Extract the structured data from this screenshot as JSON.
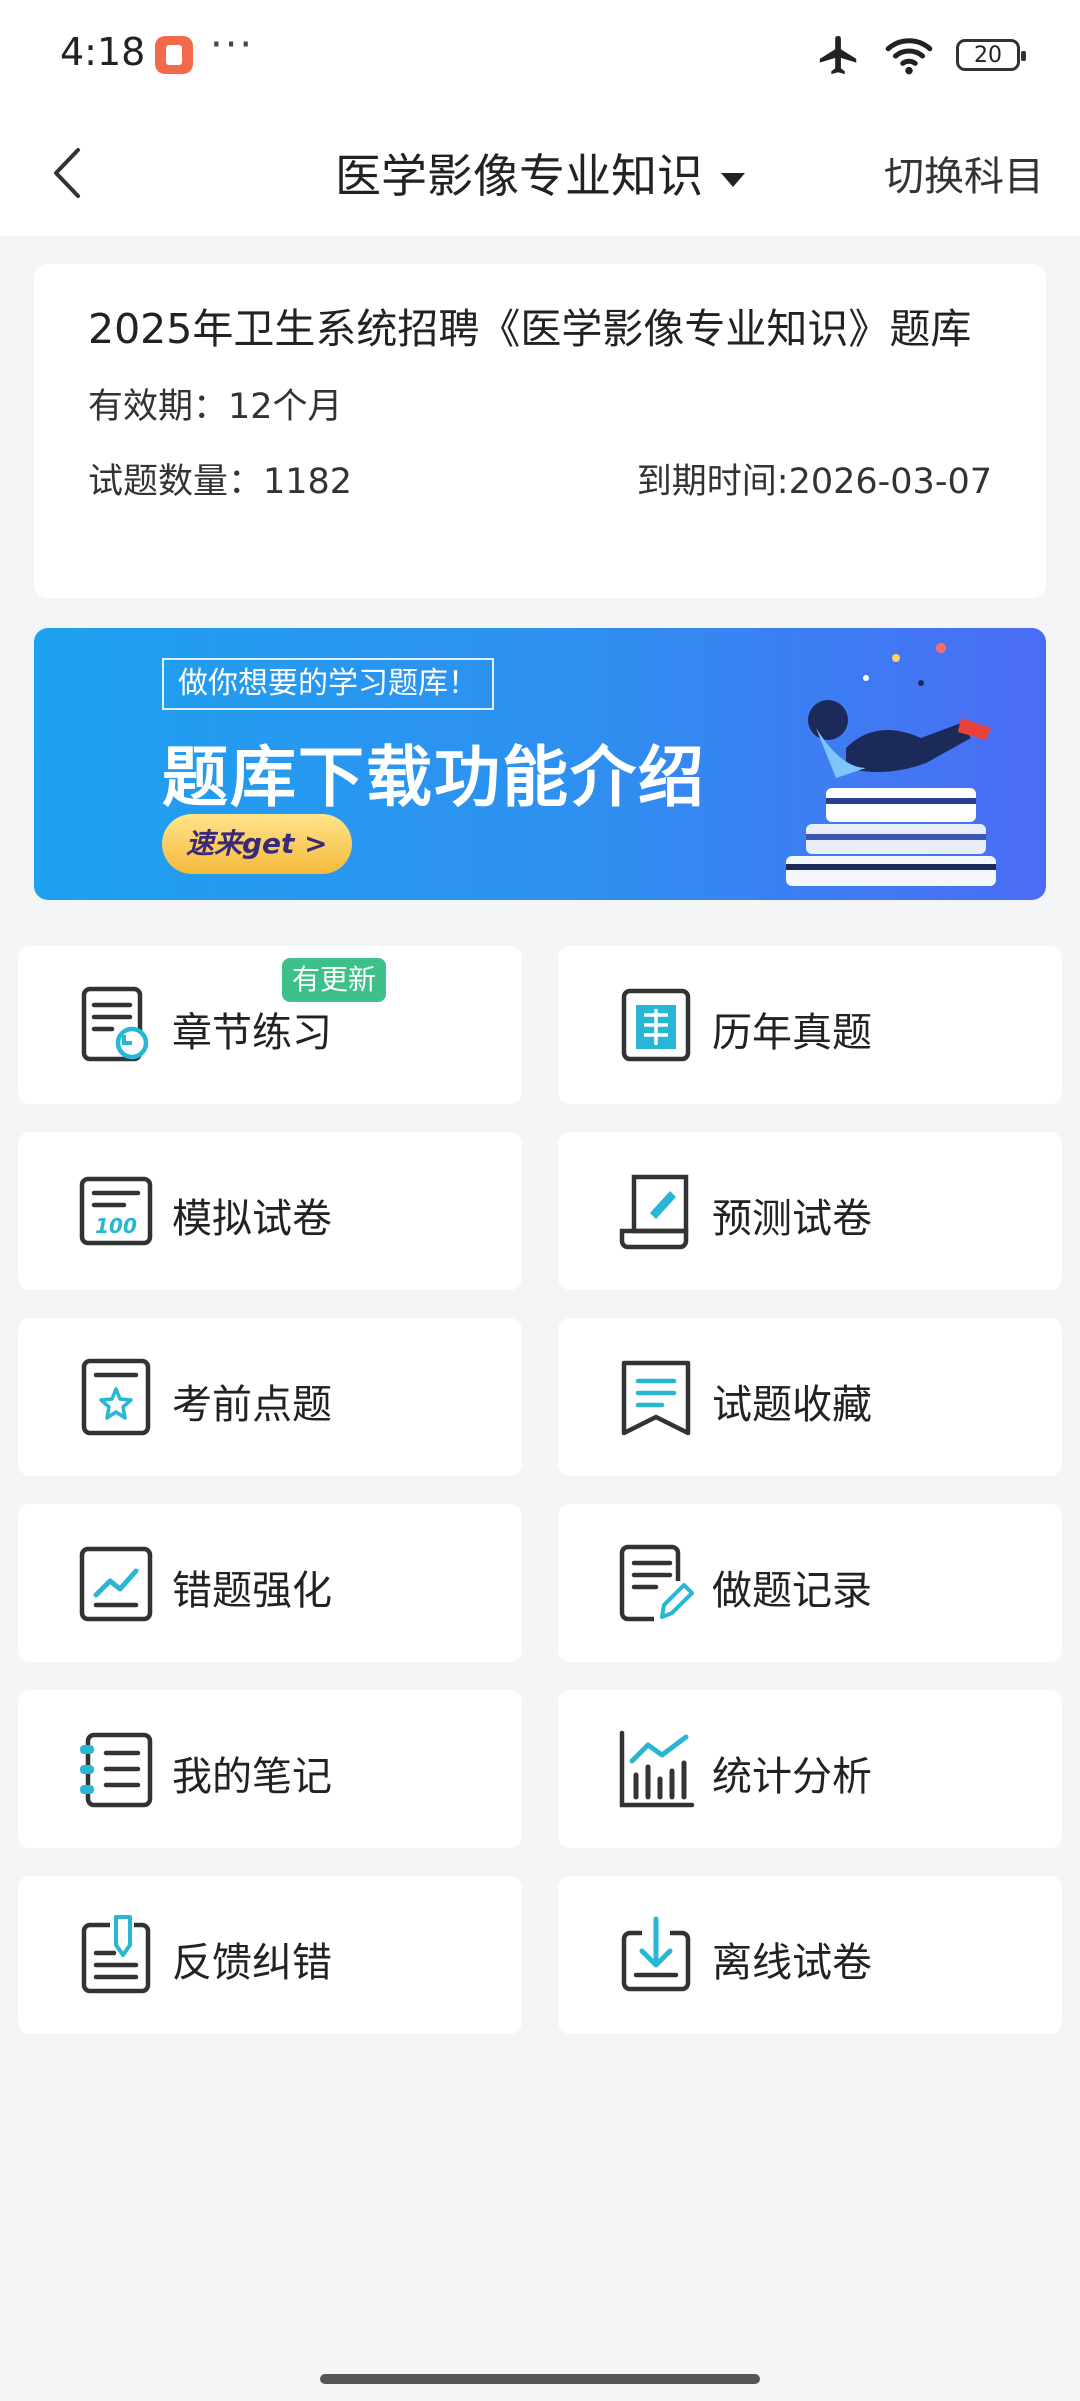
{
  "status_bar": {
    "time": "4:18",
    "more": "···",
    "battery": "20"
  },
  "nav": {
    "title": "医学影像专业知识",
    "switch": "切换科目"
  },
  "info": {
    "title": "2025年卫生系统招聘《医学影像专业知识》题库",
    "validity": "有效期：12个月",
    "count": "试题数量：1182",
    "expiry": "到期时间:2026-03-07"
  },
  "banner": {
    "tag": "做你想要的学习题库！",
    "headline": "题库下载功能介绍",
    "cta": "速来get >"
  },
  "menu": {
    "badge": "有更新",
    "items": [
      {
        "label": "章节练习",
        "icon": "chapter-practice-icon"
      },
      {
        "label": "历年真题",
        "icon": "past-exams-icon"
      },
      {
        "label": "模拟试卷",
        "icon": "mock-paper-icon"
      },
      {
        "label": "预测试卷",
        "icon": "forecast-paper-icon"
      },
      {
        "label": "考前点题",
        "icon": "pre-exam-tips-icon"
      },
      {
        "label": "试题收藏",
        "icon": "bookmark-icon"
      },
      {
        "label": "错题强化",
        "icon": "wrong-questions-icon"
      },
      {
        "label": "做题记录",
        "icon": "practice-record-icon"
      },
      {
        "label": "我的笔记",
        "icon": "notes-icon"
      },
      {
        "label": "统计分析",
        "icon": "statistics-icon"
      },
      {
        "label": "反馈纠错",
        "icon": "feedback-icon"
      },
      {
        "label": "离线试卷",
        "icon": "offline-download-icon"
      }
    ]
  },
  "colors": {
    "accent": "#27b6d4",
    "badge": "#3ec08a",
    "stroke": "#333333"
  }
}
